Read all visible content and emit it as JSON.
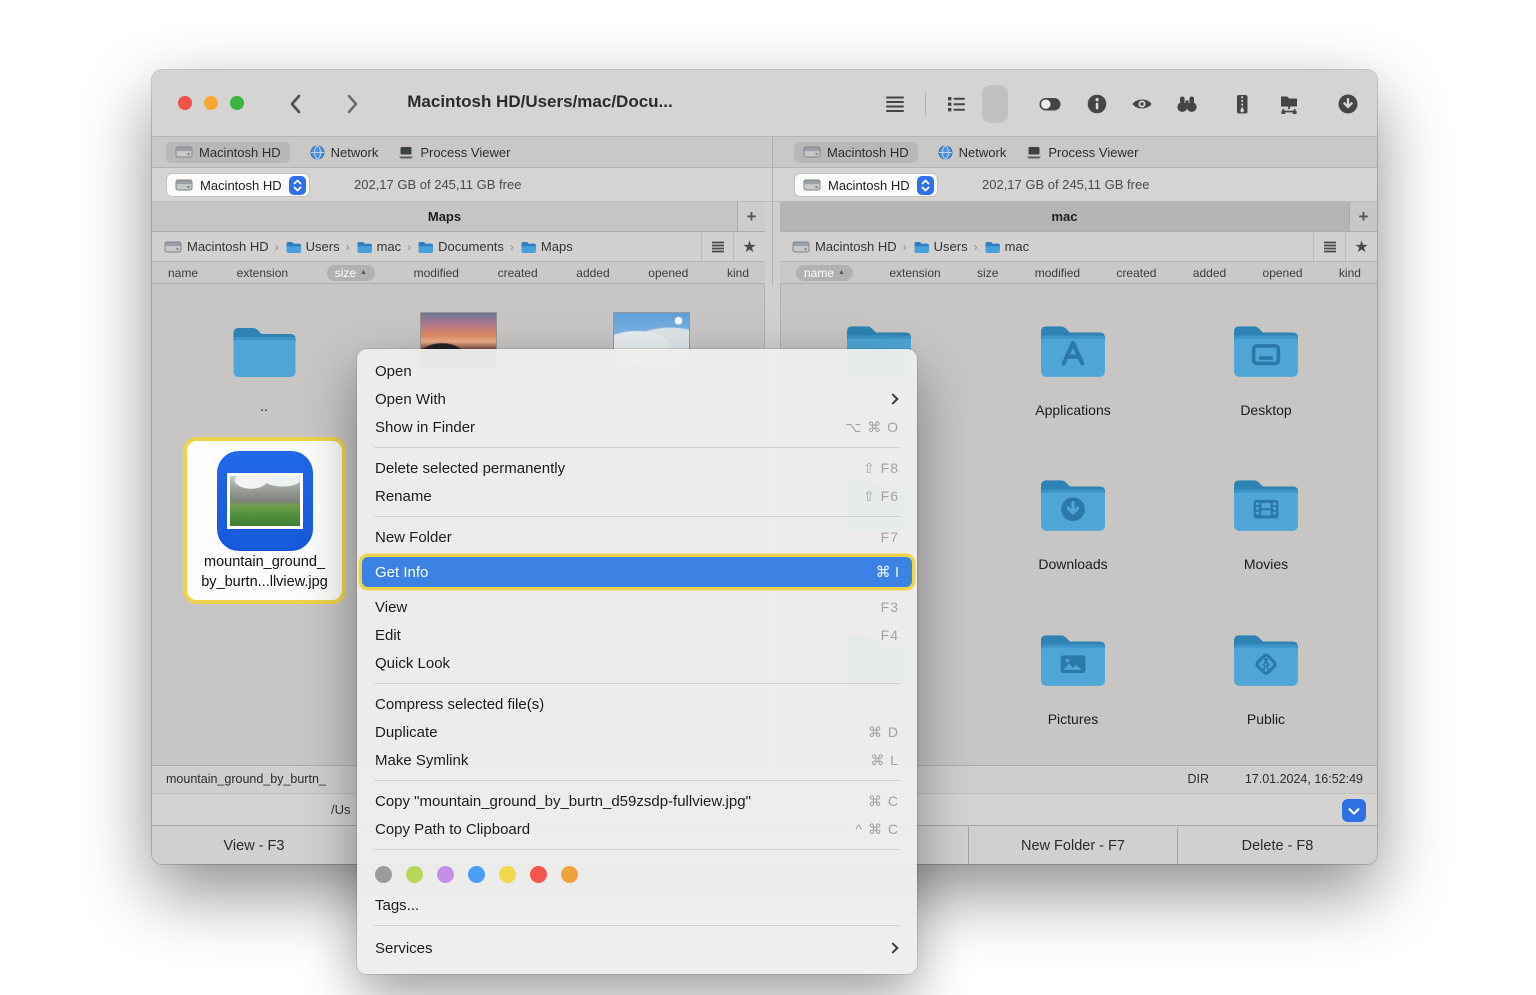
{
  "titlebar": {
    "title": "Macintosh HD/Users/mac/Docu...",
    "traffic_lights": {
      "close": "#ee5248",
      "minimize": "#f5a733",
      "zoom": "#3bb440"
    }
  },
  "toolbar": {
    "icons": [
      "full-view",
      "brief-view",
      "thumbnails-view",
      "toggle-panels",
      "info",
      "preview",
      "search",
      "archive",
      "network-share",
      "download"
    ],
    "active_icon": "thumbnails-view"
  },
  "tabs": {
    "items": [
      "Macintosh HD",
      "Network",
      "Process Viewer"
    ],
    "active": "Macintosh HD"
  },
  "drive": {
    "name": "Macintosh HD",
    "free": "202,17 GB of 245,11 GB free"
  },
  "left_pane": {
    "tab_title": "Maps",
    "add_tab": "+",
    "breadcrumb": [
      "Macintosh HD",
      "Users",
      "mac",
      "Documents",
      "Maps"
    ],
    "columns": [
      "name",
      "extension",
      "size",
      "modified",
      "created",
      "added",
      "opened",
      "kind"
    ],
    "sorted_column": "size",
    "sort_arrow": "▲",
    "up_item": "..",
    "selected_file": {
      "line1": "mountain_ground_",
      "line2": "by_burtn...llview.jpg"
    },
    "status_file": "mountain_ground_by_burtn_",
    "path_fragment": "/Us"
  },
  "right_pane": {
    "tab_title": "mac",
    "add_tab": "+",
    "breadcrumb": [
      "Macintosh HD",
      "Users",
      "mac"
    ],
    "columns": [
      "name",
      "extension",
      "size",
      "modified",
      "created",
      "added",
      "opened",
      "kind"
    ],
    "sorted_column": "name",
    "sort_arrow": "▲",
    "folders": [
      "Applications",
      "Desktop",
      "Downloads",
      "Movies",
      "Pictures",
      "Public"
    ],
    "status_kind": "DIR",
    "status_date": "17.01.2024, 16:52:49"
  },
  "menu": {
    "open": "Open",
    "open_with": "Open With",
    "show_in_finder": "Show in Finder",
    "show_in_finder_sc": "⌥ ⌘ O",
    "delete_perm": "Delete selected permanently",
    "delete_perm_sc": "⇧ F8",
    "rename": "Rename",
    "rename_sc": "⇧ F6",
    "new_folder": "New Folder",
    "new_folder_sc": "F7",
    "get_info": "Get Info",
    "get_info_sc": "⌘ I",
    "view": "View",
    "view_sc": "F3",
    "edit": "Edit",
    "edit_sc": "F4",
    "quick_look": "Quick Look",
    "compress": "Compress selected file(s)",
    "duplicate": "Duplicate",
    "duplicate_sc": "⌘ D",
    "make_symlink": "Make Symlink",
    "make_symlink_sc": "⌘ L",
    "copy_file": "Copy \"mountain_ground_by_burtn_d59zsdp-fullview.jpg\"",
    "copy_file_sc": "⌘ C",
    "copy_path": "Copy Path to Clipboard",
    "copy_path_sc": "^ ⌘ C",
    "tags": "Tags...",
    "services": "Services",
    "tag_colors": [
      "#9c9c9c",
      "#b6d75a",
      "#c490e4",
      "#4b9ef7",
      "#f2d74e",
      "#f2564d",
      "#efa23d"
    ],
    "highlight_color": "#3c82e4",
    "annotation_color": "#eed44c"
  },
  "bottom_bar": {
    "view": "View - F3",
    "new_folder": "New Folder - F7",
    "delete": "Delete - F8"
  }
}
